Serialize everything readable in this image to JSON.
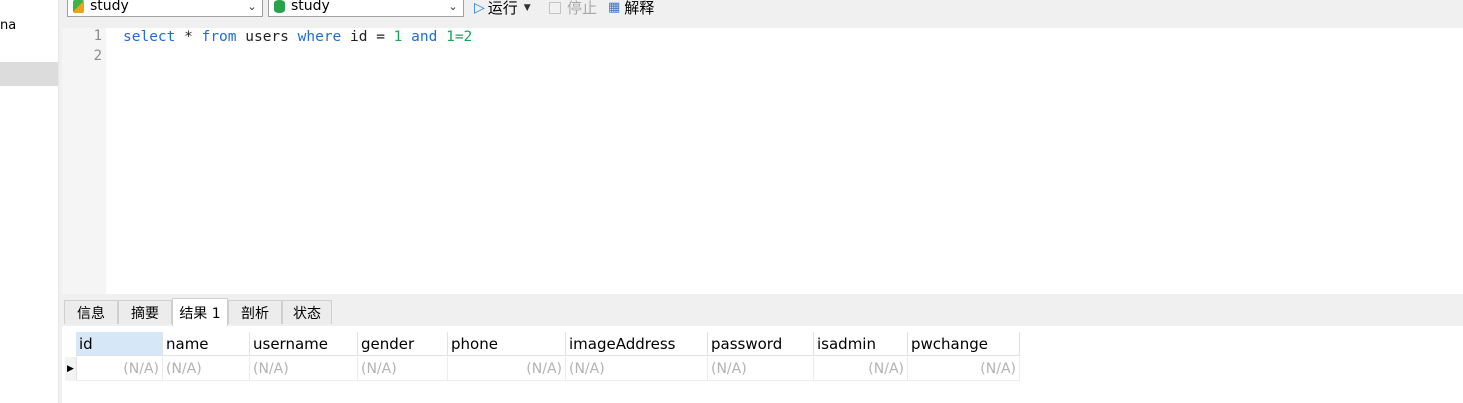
{
  "sidebar": {
    "fragment_text": "na"
  },
  "toolbar": {
    "connection": "study",
    "database": "study",
    "run_label": "运行",
    "stop_label": "停止",
    "explain_label": "解释"
  },
  "editor": {
    "line_numbers": [
      "1",
      "2"
    ],
    "tokens": {
      "t1": "select",
      "t2": " * ",
      "t3": "from",
      "t4": " users ",
      "t5": "where",
      "t6": " id = ",
      "t7": "1",
      "t8": " ",
      "t9": "and",
      "t10": " ",
      "t11": "1",
      "t12": "=2"
    }
  },
  "result_tabs": [
    "信息",
    "摘要",
    "结果 1",
    "剖析",
    "状态"
  ],
  "active_tab": "结果 1",
  "grid": {
    "columns": [
      "id",
      "name",
      "username",
      "gender",
      "phone",
      "imageAddress",
      "password",
      "isadmin",
      "pwchange"
    ],
    "row": [
      "(N/A)",
      "(N/A)",
      "(N/A)",
      "(N/A)",
      "(N/A)",
      "(N/A)",
      "(N/A)",
      "(N/A)",
      "(N/A)"
    ]
  },
  "colors": {
    "keyword": "#1e6ed8",
    "number": "#19a560",
    "selected_header": "#d6e8f8",
    "run_icon": "#1e7be0"
  },
  "icons": {
    "connection": "connection-icon",
    "database": "database-icon",
    "run": "play-icon",
    "stop": "stop-icon",
    "explain": "explain-icon",
    "row_marker": "current-row-icon"
  }
}
